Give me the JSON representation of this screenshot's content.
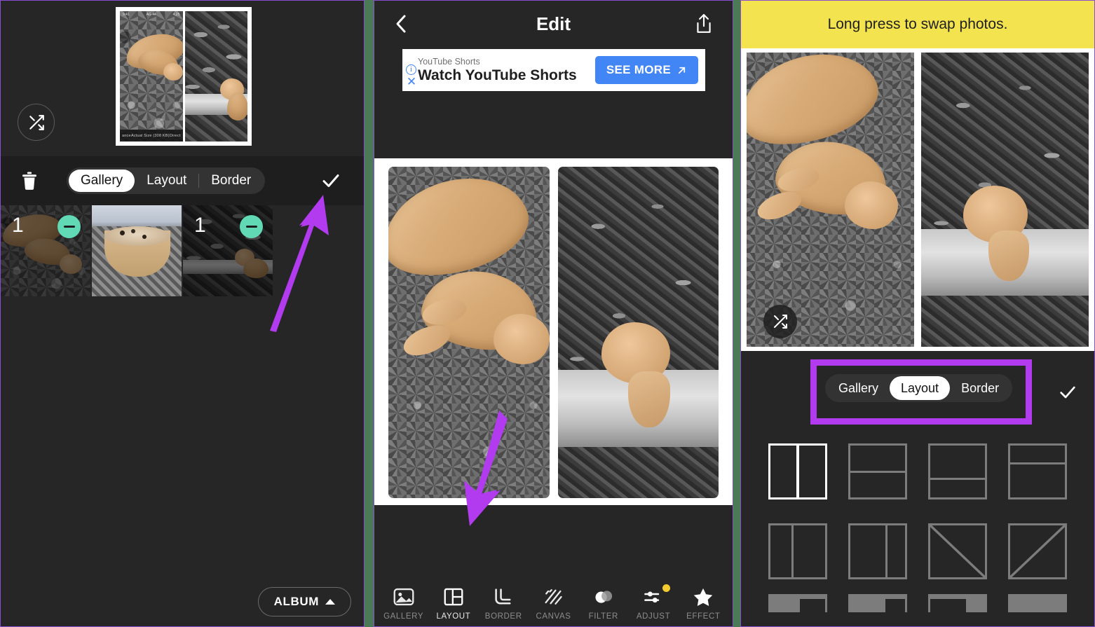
{
  "accent": {
    "purple": "#b23bf0",
    "yellow": "#f2e34f",
    "blue": "#4285f4",
    "teal": "#62d9b5",
    "panel_border": "#8a4fd0"
  },
  "panel_left": {
    "name": "collage-editor-gallery-tab",
    "preview": {
      "status_left": "ance",
      "status_center": "Actual Size (308 KB)",
      "status_right": "Direct",
      "top_left": "9:41",
      "top_center": "AG 44",
      "top_right": "4,25"
    },
    "shuffle_icon": "shuffle-icon",
    "toolbar": {
      "trash_icon": "trash-icon",
      "check_icon": "check-icon",
      "tabs": [
        {
          "label": "Gallery",
          "active": true
        },
        {
          "label": "Layout",
          "active": false
        },
        {
          "label": "Border",
          "active": false
        }
      ]
    },
    "thumbnails": [
      {
        "name": "thumb-cat-asphalt",
        "count": "1",
        "has_minus": true,
        "selected": true
      },
      {
        "name": "thumb-cookie-bowl",
        "count": "",
        "has_minus": false,
        "selected": false
      },
      {
        "name": "thumb-cat-leaves",
        "count": "1",
        "has_minus": true,
        "selected": true
      }
    ],
    "album_button": "ALBUM"
  },
  "panel_mid": {
    "name": "collage-editor-main",
    "header": {
      "back_icon": "chevron-left-icon",
      "title": "Edit",
      "share_icon": "share-icon"
    },
    "ad": {
      "info_icon": "info-icon",
      "close_icon": "close-icon",
      "advertiser": "YouTube Shorts",
      "headline": "Watch YouTube Shorts",
      "cta_label": "SEE MORE",
      "cta_icon": "external-link-icon"
    },
    "shuffle_icon": "shuffle-icon",
    "tools": [
      {
        "label": "GALLERY",
        "icon": "image-icon",
        "active": false,
        "badge": false
      },
      {
        "label": "LAYOUT",
        "icon": "layout-grid-icon",
        "active": true,
        "badge": false
      },
      {
        "label": "BORDER",
        "icon": "corner-radius-icon",
        "active": false,
        "badge": false
      },
      {
        "label": "CANVAS",
        "icon": "diagonal-stripes-icon",
        "active": false,
        "badge": false
      },
      {
        "label": "FILTER",
        "icon": "circles-overlap-icon",
        "active": false,
        "badge": false
      },
      {
        "label": "ADJUST",
        "icon": "sliders-icon",
        "active": false,
        "badge": true
      },
      {
        "label": "EFFECT",
        "icon": "star-icon",
        "active": false,
        "badge": false
      }
    ]
  },
  "panel_right": {
    "name": "collage-editor-layout-tab",
    "toast": "Long press to swap photos.",
    "shuffle_icon": "shuffle-icon",
    "check_icon": "check-icon",
    "tabs": [
      {
        "label": "Gallery",
        "active": false
      },
      {
        "label": "Layout",
        "active": true
      },
      {
        "label": "Border",
        "active": false
      }
    ],
    "layouts": [
      {
        "name": "layout-two-columns-equal",
        "selected": true
      },
      {
        "name": "layout-two-rows-equal",
        "selected": false
      },
      {
        "name": "layout-two-rows-top-large",
        "selected": false
      },
      {
        "name": "layout-two-rows-bottom-large",
        "selected": false
      },
      {
        "name": "layout-two-columns-left-narrow",
        "selected": false
      },
      {
        "name": "layout-two-columns-right-narrow",
        "selected": false
      },
      {
        "name": "layout-diagonal-down",
        "selected": false
      },
      {
        "name": "layout-diagonal-up",
        "selected": false
      }
    ]
  },
  "annotations": [
    {
      "name": "arrow-to-left-check",
      "color": "#b23bf0"
    },
    {
      "name": "arrow-to-layout-tool",
      "color": "#b23bf0"
    },
    {
      "name": "highlight-box-layout-tabs",
      "color": "#b23bf0"
    }
  ]
}
